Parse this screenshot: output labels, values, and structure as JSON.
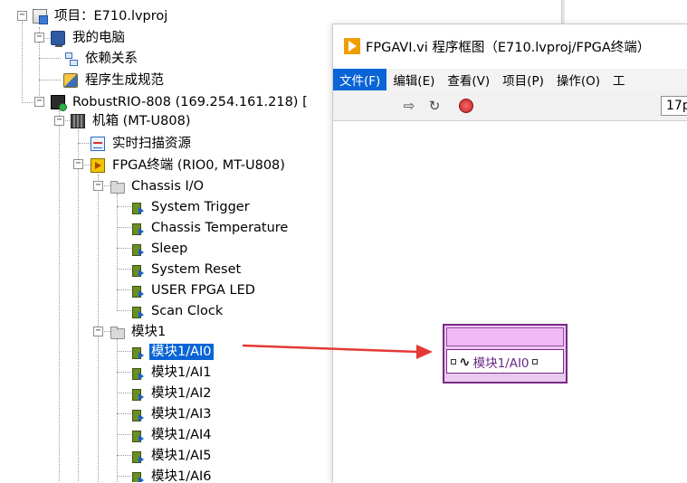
{
  "tree": {
    "project": "项目：E710.lvproj",
    "my_computer": "我的电脑",
    "dependencies": "依赖关系",
    "build_specs": "程序生成规范",
    "target": "RobustRIO-808 (169.254.161.218) [",
    "chassis": "机箱 (MT-U808)",
    "scan_resources": "实时扫描资源",
    "fpga_target": "FPGA终端 (RIO0, MT-U808)",
    "chassis_io": {
      "label": "Chassis I/O",
      "items": [
        "System Trigger",
        "Chassis Temperature",
        "Sleep",
        "System Reset",
        "USER FPGA LED",
        "Scan Clock"
      ]
    },
    "module1": {
      "label": "模块1",
      "items": [
        "模块1/AI0",
        "模块1/AI1",
        "模块1/AI2",
        "模块1/AI3",
        "模块1/AI4",
        "模块1/AI5",
        "模块1/AI6"
      ],
      "selected_index": 0
    }
  },
  "block_diagram": {
    "title": "FPGAVI.vi 程序框图（E710.lvproj/FPGA终端）",
    "menu": [
      "文件(F)",
      "编辑(E)",
      "查看(V)",
      "项目(P)",
      "操作(O)",
      "工"
    ],
    "active_menu_index": 0,
    "font_size_value": "17p",
    "io_node": {
      "label": "模块1/AI0",
      "icon": "waveform-icon"
    }
  },
  "colors": {
    "selection": "#0a64d6",
    "arrow": "#e53935",
    "io_node_border": "#7a2a86",
    "io_node_fill": "#f0b9f5"
  }
}
